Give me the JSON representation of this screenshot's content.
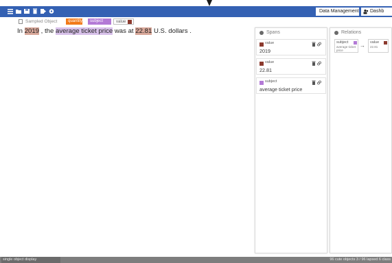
{
  "toolbar": {
    "icons": [
      "list-icon",
      "folder-icon",
      "save-icon",
      "delete-icon",
      "next-icon",
      "settings-icon"
    ],
    "data_management_label": "Data Management",
    "dashboard_label": "Dashb"
  },
  "subbar": {
    "sampled_label": "Sampled Object",
    "legend": {
      "quantity": "quantity",
      "subject": "subject",
      "value": "value"
    }
  },
  "document": {
    "parts": {
      "p1": "In ",
      "v1": "2019",
      "p2": " , the ",
      "s1": "average ticket price",
      "p3": " was at ",
      "v2": "22.81",
      "p4": " U.S. dollars ."
    }
  },
  "spans_panel": {
    "title": "Spans",
    "items": [
      {
        "tag": "value",
        "text": "2019"
      },
      {
        "tag": "value",
        "text": "22.81"
      },
      {
        "tag": "subject",
        "text": "average ticket price"
      }
    ]
  },
  "relations_panel": {
    "title": "Relations",
    "source_label": "subject",
    "source_text": "average ticket price",
    "target_label": "value",
    "target_text": "22.81"
  },
  "statusbar": {
    "left": "single object display",
    "right": "96 cute objects   3 / 96 lapsed   6 class"
  },
  "colors": {
    "topbar": "#3461b3",
    "value": "#8c3a2e",
    "value_highlight": "#d9a89a",
    "subject": "#b37ad6",
    "subject_highlight": "#d8c1ea",
    "quantity": "#f27a1a"
  }
}
